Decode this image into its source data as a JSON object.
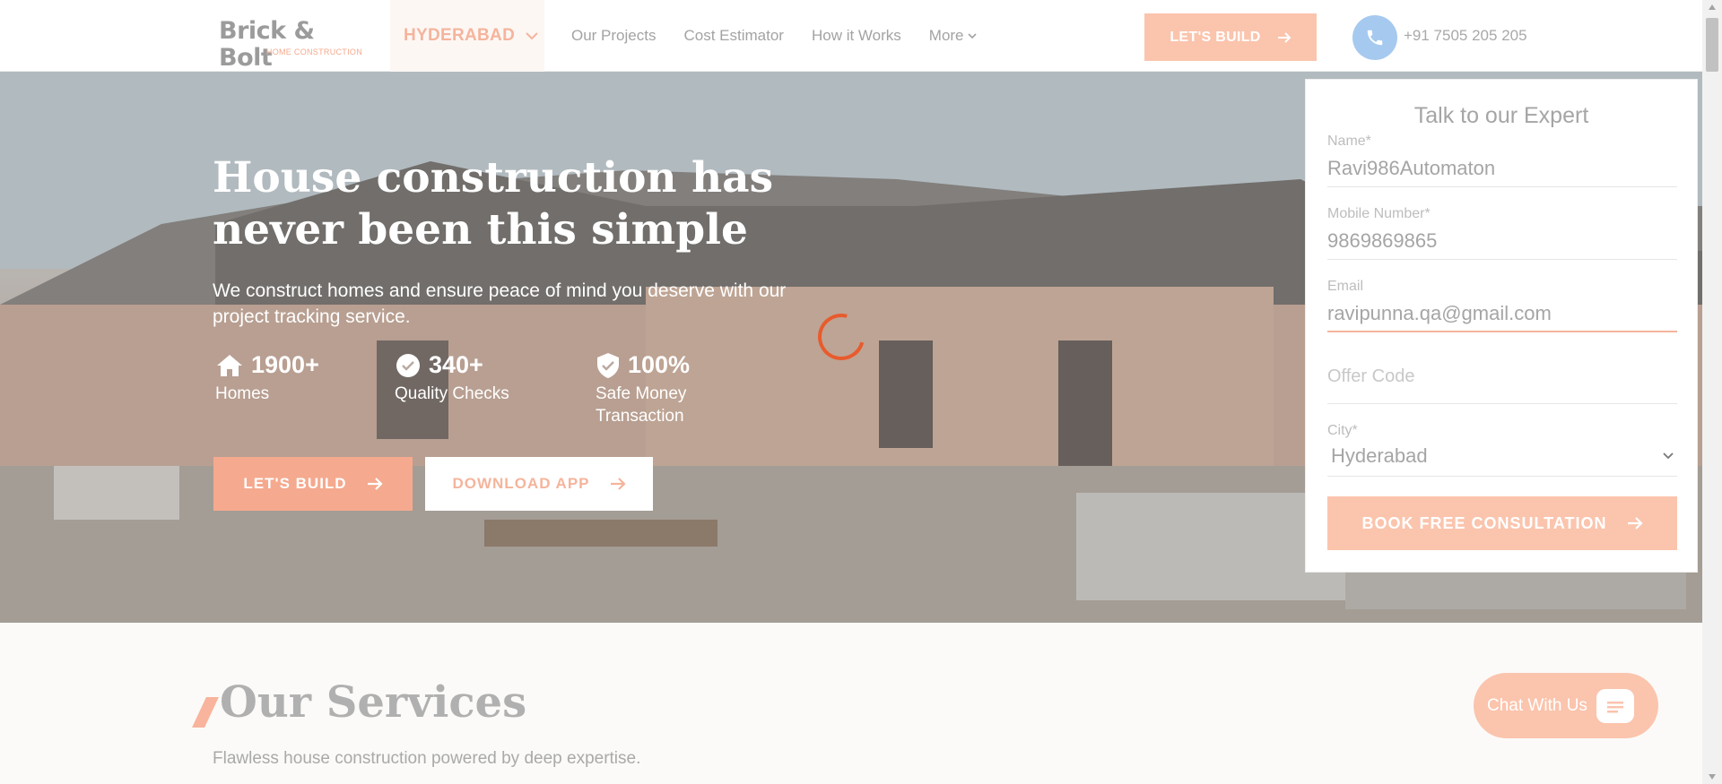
{
  "header": {
    "logo_main": "Brick & Bolt",
    "logo_sub": "HOME CONSTRUCTION",
    "city": "HYDERABAD",
    "nav": [
      "Our Projects",
      "Cost Estimator",
      "How it Works"
    ],
    "nav_more": "More",
    "cta_label": "LET'S BUILD",
    "phone": "+91 7505 205 205"
  },
  "hero": {
    "title": "House construction has never been this simple",
    "description": "We construct homes and ensure peace of mind you deserve with our project tracking service.",
    "stats": [
      {
        "value": "1900+",
        "label": "Homes",
        "icon": "home-icon"
      },
      {
        "value": "340+",
        "label": "Quality Checks",
        "icon": "check-badge-icon"
      },
      {
        "value": "100%",
        "label": "Safe Money Transaction",
        "icon": "shield-check-icon"
      }
    ],
    "btn_build": "LET'S BUILD",
    "btn_download": "DOWNLOAD APP"
  },
  "form": {
    "title": "Talk to our Expert",
    "name_label": "Name*",
    "name_value": "Ravi986Automaton",
    "mobile_label": "Mobile Number*",
    "mobile_value": "9869869865",
    "email_label": "Email",
    "email_value": "ravipunna.qa@gmail.com",
    "offer_placeholder": "Offer Code",
    "city_label": "City*",
    "city_value": "Hyderabad",
    "submit_label": "BOOK FREE CONSULTATION"
  },
  "services": {
    "title": "Our Services",
    "subtitle": "Flawless house construction powered by deep expertise."
  },
  "chat": {
    "label": "Chat With Us"
  },
  "colors": {
    "accent": "#f5a98e",
    "spinner": "#e85b2d",
    "phone_bg": "#a6c9ef"
  }
}
